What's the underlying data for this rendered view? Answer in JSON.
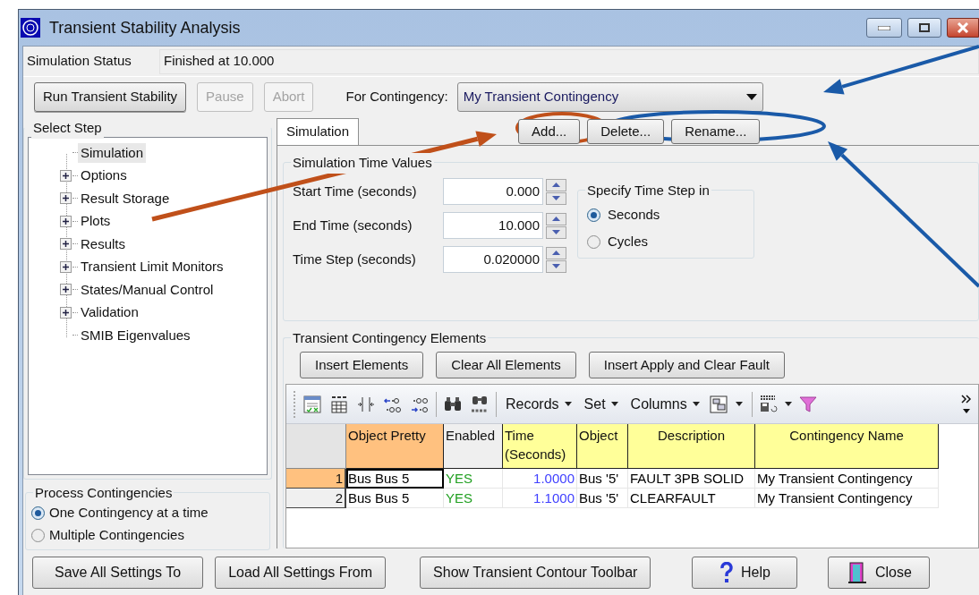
{
  "window": {
    "title": "Transient Stability Analysis"
  },
  "status": {
    "label": "Simulation Status",
    "value": "Finished at 10.000"
  },
  "top_buttons": [
    {
      "label": "Run Transient Stability",
      "disabled": false
    },
    {
      "label": "Pause",
      "disabled": true
    },
    {
      "label": "Abort",
      "disabled": true
    }
  ],
  "contingency": {
    "label": "For Contingency:",
    "value": "My Transient Contingency"
  },
  "contingency_buttons": [
    "Add...",
    "Delete...",
    "Rename..."
  ],
  "select_step": {
    "title": "Select Step",
    "items": [
      {
        "label": "Simulation",
        "kind": "leaf",
        "selected": true
      },
      {
        "label": "Options",
        "kind": "folder",
        "expanded": false,
        "selected": false
      },
      {
        "label": "Result Storage",
        "kind": "folder",
        "expanded": false,
        "selected": false
      },
      {
        "label": "Plots",
        "kind": "folder",
        "expanded": false,
        "selected": false
      },
      {
        "label": "Results",
        "kind": "folder",
        "expanded": false,
        "selected": false
      },
      {
        "label": "Transient Limit Monitors",
        "kind": "folder",
        "expanded": false,
        "selected": false
      },
      {
        "label": "States/Manual Control",
        "kind": "folder",
        "expanded": false,
        "selected": false
      },
      {
        "label": "Validation",
        "kind": "folder",
        "expanded": false,
        "selected": false
      },
      {
        "label": "SMIB Eigenvalues",
        "kind": "leaf",
        "selected": false
      }
    ]
  },
  "process_contingencies": {
    "title": "Process Contingencies",
    "options": [
      {
        "label": "One Contingency at a time",
        "selected": true
      },
      {
        "label": "Multiple Contingencies",
        "selected": false
      }
    ]
  },
  "tabs": [
    {
      "label": "Simulation",
      "selected": true
    }
  ],
  "time_values": {
    "title": "Simulation Time Values",
    "fields": [
      {
        "label": "Start Time (seconds)",
        "value": "0.000"
      },
      {
        "label": "End Time (seconds)",
        "value": "10.000"
      },
      {
        "label": "Time Step (seconds)",
        "value": "0.020000"
      }
    ]
  },
  "time_step_unit": {
    "title": "Specify Time Step in",
    "options": [
      {
        "label": "Seconds",
        "selected": true
      },
      {
        "label": "Cycles",
        "selected": false
      }
    ]
  },
  "elements": {
    "title": "Transient Contingency Elements",
    "buttons": [
      "Insert Elements",
      "Clear All Elements",
      "Insert Apply and Clear Fault"
    ],
    "menus": [
      "Records",
      "Set",
      "Columns"
    ],
    "columns": [
      {
        "label": "Object Pretty",
        "kind": "text",
        "selected": true
      },
      {
        "label": "Enabled",
        "kind": "status",
        "selected": false
      },
      {
        "label": "Time (Seconds)",
        "kind": "number",
        "selected": false
      },
      {
        "label": "Object",
        "kind": "text",
        "selected": false
      },
      {
        "label": "Description",
        "kind": "text",
        "selected": false
      },
      {
        "label": "Contingency Name",
        "kind": "text",
        "selected": false
      }
    ],
    "rows": [
      {
        "number": "1",
        "selected": true,
        "cells": [
          "Bus Bus 5",
          "YES",
          "1.0000",
          "Bus '5'",
          "FAULT 3PB SOLID",
          "My Transient Contingency"
        ]
      },
      {
        "number": "2",
        "selected": false,
        "cells": [
          "Bus Bus 5",
          "YES",
          "1.1000",
          "Bus '5'",
          "CLEARFAULT",
          "My Transient Contingency"
        ]
      }
    ]
  },
  "bottom_buttons": [
    {
      "label": "Save All Settings To",
      "kind": "plain"
    },
    {
      "label": "Load All Settings From",
      "kind": "plain"
    },
    {
      "label": "Show Transient Contour Toolbar",
      "kind": "plain"
    },
    {
      "label": "Help",
      "kind": "help"
    },
    {
      "label": "Close",
      "kind": "close"
    }
  ]
}
